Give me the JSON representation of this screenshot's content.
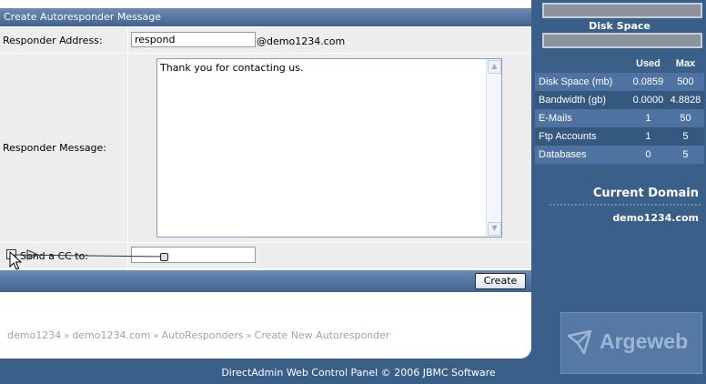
{
  "form": {
    "header_title": "Create Autoresponder Message",
    "responder_address_label": "Responder Address:",
    "responder_address_value": "respond",
    "domain_suffix": "@demo1234.com",
    "responder_message_label": "Responder Message:",
    "responder_message_value": "Thank you for contacting us.",
    "send_cc_label": "Send a CC to:",
    "send_cc_value": "",
    "create_button": "Create"
  },
  "breadcrumb": {
    "items": [
      "demo1234",
      "demo1234.com",
      "AutoResponders",
      "Create New Autoresponder"
    ],
    "separator": "»"
  },
  "footer": {
    "copyright": "DirectAdmin Web Control Panel © 2006 JBMC Software"
  },
  "sidebar": {
    "disk_space_title": "Disk Space",
    "stats_headers": {
      "used": "Used",
      "max": "Max"
    },
    "stats": [
      {
        "name": "Disk Space (mb)",
        "used": "0.0859",
        "max": "500"
      },
      {
        "name": "Bandwidth (gb)",
        "used": "0.0000",
        "max": "4.8828"
      },
      {
        "name": "E-Mails",
        "used": "1",
        "max": "50"
      },
      {
        "name": "Ftp Accounts",
        "used": "1",
        "max": "5"
      },
      {
        "name": "Databases",
        "used": "0",
        "max": "5"
      }
    ],
    "current_domain_title": "Current Domain",
    "current_domain": "demo1234.com",
    "logo_text": "Argeweb"
  },
  "icons": {
    "scroll_up": "chevron-up-icon",
    "scroll_down": "chevron-down-icon",
    "cursor": "mouse-pointer-icon",
    "logo": "argeweb-logo-icon"
  },
  "colors": {
    "page_bg": "#3a5f88",
    "header_bar": "#4f6f9c",
    "row_bg": "#ededed",
    "logo_text": "#9db6d6"
  }
}
